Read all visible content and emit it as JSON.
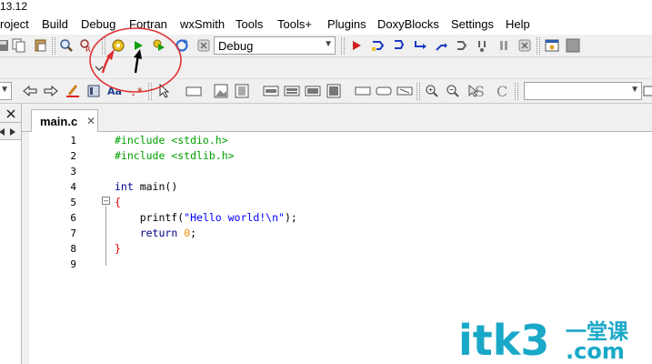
{
  "window": {
    "title_fragment": "13.12"
  },
  "menu": [
    "roject",
    "Build",
    "Debug",
    "Fortran",
    "wxSmith",
    "Tools",
    "Tools+",
    "Plugins",
    "DoxyBlocks",
    "Settings",
    "Help"
  ],
  "build_target": {
    "value": "Debug"
  },
  "editor": {
    "tab_label": "main.c",
    "lines": [
      [
        {
          "t": "#include <stdio.h>",
          "c": "pre"
        }
      ],
      [
        {
          "t": "#include <stdlib.h>",
          "c": "pre"
        }
      ],
      [],
      [
        {
          "t": "int",
          "c": "kw"
        },
        {
          "t": " main()",
          "c": ""
        }
      ],
      [
        {
          "t": "{",
          "c": "brace"
        }
      ],
      [
        {
          "t": "    printf(",
          "c": ""
        },
        {
          "t": "\"Hello world!\\n\"",
          "c": "str"
        },
        {
          "t": ");",
          "c": ""
        }
      ],
      [
        {
          "t": "    ",
          "c": ""
        },
        {
          "t": "return",
          "c": "kw"
        },
        {
          "t": " ",
          "c": ""
        },
        {
          "t": "0",
          "c": "num"
        },
        {
          "t": ";",
          "c": ""
        }
      ],
      [
        {
          "t": "}",
          "c": "brace"
        }
      ],
      []
    ],
    "line_numbers": [
      "1",
      "2",
      "3",
      "4",
      "5",
      "6",
      "7",
      "8",
      "9"
    ]
  },
  "watermark": {
    "text": "itk3",
    "suffix": ".com",
    "chinese": "一堂课"
  },
  "colors": {
    "preprocessor": "#00a000",
    "keyword": "#00008b",
    "string": "#0000ff",
    "number": "#f09000",
    "brace": "#e00000",
    "annotation_circle": "#e03030",
    "watermark": "#1aa8c8"
  }
}
